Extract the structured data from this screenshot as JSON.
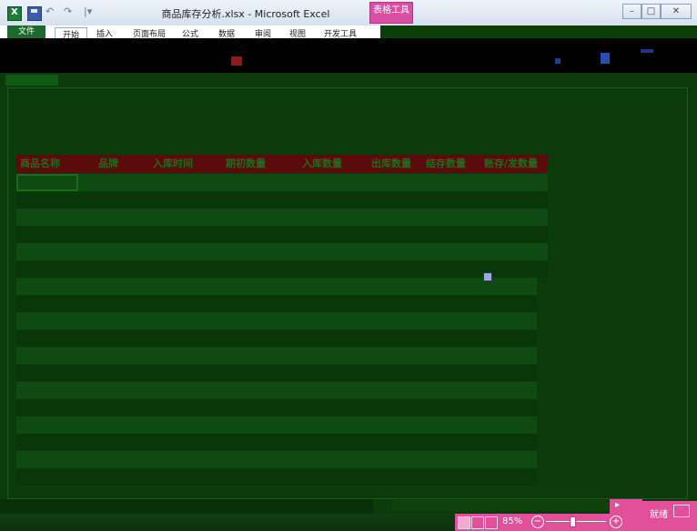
{
  "window": {
    "title": "商品库存分析.xlsx - Microsoft Excel",
    "context_tab": "表格工具",
    "min_glyph": "–",
    "max_glyph": "□",
    "close_glyph": "✕"
  },
  "quick_access": {
    "undo_glyph": "↶",
    "redo_glyph": "↷",
    "customize_glyph": "|▾"
  },
  "ribbon": {
    "tabs": [
      "文件",
      "开始",
      "插入",
      "页面布局",
      "公式",
      "数据",
      "审阅",
      "视图",
      "开发工具"
    ]
  },
  "table": {
    "headers": [
      "商品名称",
      "品牌",
      "入库时间",
      "期初数量",
      "入库数量",
      "出库数量",
      "结存数量",
      "账存/发数量"
    ]
  },
  "status": {
    "ready": "就绪",
    "zoom": "85%",
    "zoom_level": 0.85,
    "minus": "−",
    "plus": "+"
  },
  "colors": {
    "context_tab": "#d84fa3",
    "status_accent": "#e2509b",
    "header_row": "#5b0b0b"
  }
}
